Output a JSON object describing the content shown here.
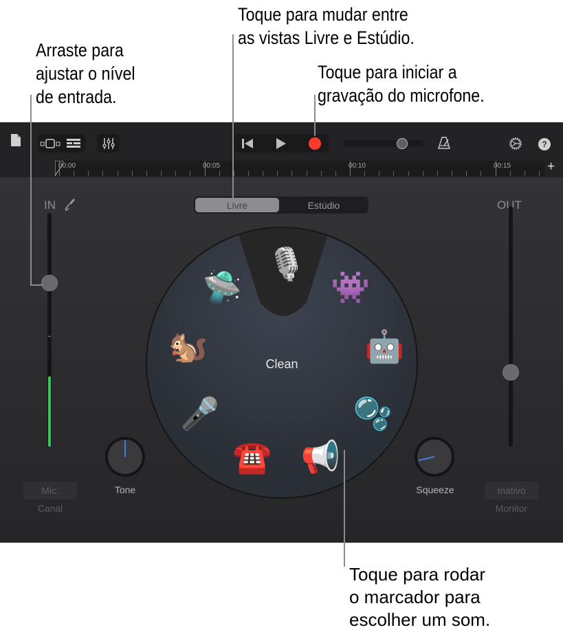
{
  "callouts": {
    "input_level": "Arraste para\najustar o nível\nde entrada.",
    "view_toggle": "Toque para mudar entre\nas vistas Livre e Estúdio.",
    "record": "Toque para iniciar a\ngravação do microfone.",
    "dial": "Toque para rodar\no marcador para\nescolher um som."
  },
  "toolbar": {
    "icons": {
      "document": "document-icon",
      "tracks_view": "tracks-view-icon",
      "browser": "browser-icon",
      "mixer": "mixer-icon",
      "rewind": "go-to-beginning-icon",
      "play": "play-icon",
      "record": "record-icon",
      "metronome": "metronome-icon",
      "settings": "settings-icon",
      "help": "help-icon"
    },
    "master_volume": 0.77,
    "record_color": "#ff3b30"
  },
  "ruler": {
    "labels": [
      "00:00",
      "00:05",
      "00:10",
      "00:15"
    ],
    "add_label": "+"
  },
  "view_switch": {
    "options": [
      "Livre",
      "Estúdio"
    ],
    "selected": "Livre"
  },
  "input": {
    "label": "IN",
    "icon": "input-cable-icon",
    "level": 0.7,
    "meter_level": 0.3,
    "meter_color": "#34c759",
    "channel_value": "Mic.",
    "channel_caption": "Canal"
  },
  "output": {
    "label": "OUT",
    "level": 0.31,
    "monitor_value": "Inativo",
    "monitor_caption": "Monitor"
  },
  "dial": {
    "selected": "Clean",
    "presets": [
      {
        "name": "clean-microphone",
        "glyph": "🎙️"
      },
      {
        "name": "monster",
        "glyph": "👾"
      },
      {
        "name": "robot",
        "glyph": "🤖"
      },
      {
        "name": "bubbles",
        "glyph": "🫧"
      },
      {
        "name": "megaphone",
        "glyph": "📢"
      },
      {
        "name": "telephone",
        "glyph": "☎️"
      },
      {
        "name": "karaoke-mic",
        "glyph": "🎤"
      },
      {
        "name": "chipmunk",
        "glyph": "🐿️"
      },
      {
        "name": "ufo",
        "glyph": "🛸"
      }
    ]
  },
  "knobs": {
    "tone": {
      "label": "Tone",
      "value": 0.5
    },
    "squeeze": {
      "label": "Squeeze",
      "value": 0.12
    }
  }
}
